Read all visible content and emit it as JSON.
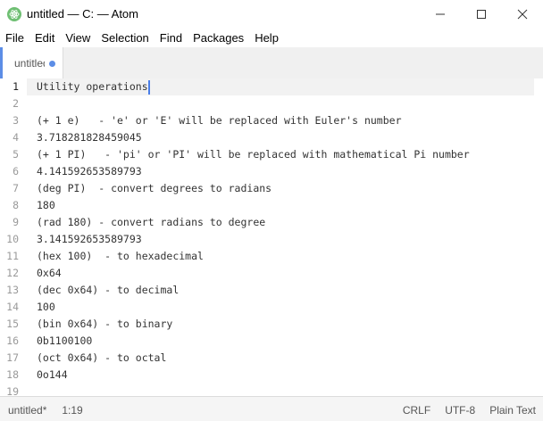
{
  "window": {
    "title": "untitled — C: — Atom",
    "controls": [
      "minimize",
      "maximize",
      "close"
    ]
  },
  "menu": [
    "File",
    "Edit",
    "View",
    "Selection",
    "Find",
    "Packages",
    "Help"
  ],
  "tab": {
    "label": "untitled",
    "modified": true
  },
  "editor": {
    "lines": [
      {
        "n": "1",
        "text": "Utility operations"
      },
      {
        "n": "2",
        "text": ""
      },
      {
        "n": "3",
        "text": "(+ 1 e)   - 'e' or 'E' will be replaced with Euler's number"
      },
      {
        "n": "4",
        "text": "3.718281828459045"
      },
      {
        "n": "5",
        "text": "(+ 1 PI)   - 'pi' or 'PI' will be replaced with mathematical Pi number"
      },
      {
        "n": "6",
        "text": "4.141592653589793"
      },
      {
        "n": "7",
        "text": "(deg PI)  - convert degrees to radians"
      },
      {
        "n": "8",
        "text": "180"
      },
      {
        "n": "9",
        "text": "(rad 180) - convert radians to degree"
      },
      {
        "n": "10",
        "text": "3.141592653589793"
      },
      {
        "n": "11",
        "text": "(hex 100)  - to hexadecimal"
      },
      {
        "n": "12",
        "text": "0x64"
      },
      {
        "n": "13",
        "text": "(dec 0x64) - to decimal"
      },
      {
        "n": "14",
        "text": "100"
      },
      {
        "n": "15",
        "text": "(bin 0x64) - to binary"
      },
      {
        "n": "16",
        "text": "0b1100100"
      },
      {
        "n": "17",
        "text": "(oct 0x64) - to octal"
      },
      {
        "n": "18",
        "text": "0o144"
      },
      {
        "n": "19",
        "text": ""
      }
    ]
  },
  "status": {
    "file": "untitled*",
    "cursor": "1:19",
    "line_ending": "CRLF",
    "encoding": "UTF-8",
    "grammar": "Plain Text"
  },
  "colors": {
    "accent": "#5c8de6",
    "app_icon": "#6fbf73"
  }
}
